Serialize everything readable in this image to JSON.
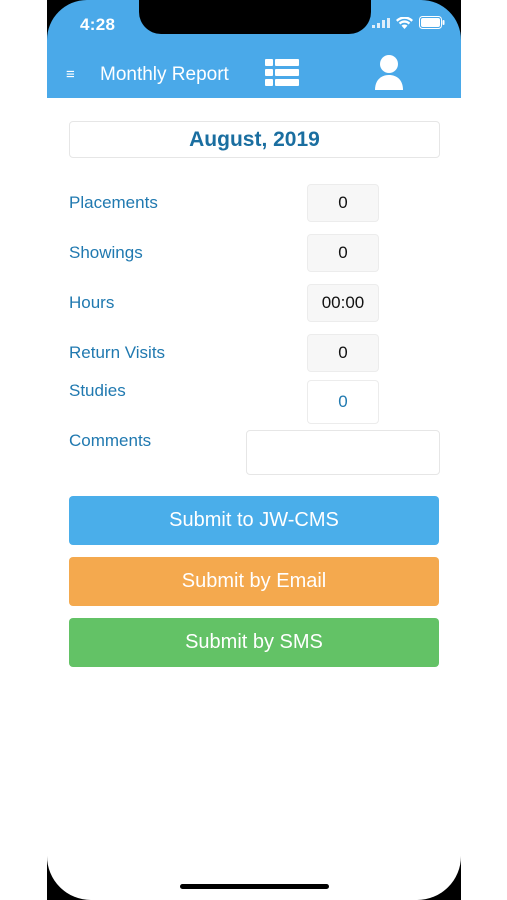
{
  "status_bar": {
    "time": "4:28",
    "icons": [
      "signal-icon",
      "wifi-icon",
      "battery-icon"
    ]
  },
  "header": {
    "menu_icon": "≡",
    "title": "Monthly Report",
    "list_icon": "list-icon",
    "user_icon": "user-icon",
    "background": "#4aa9e9"
  },
  "report": {
    "month": "August, 2019",
    "fields": [
      {
        "label": "Placements",
        "value": "0"
      },
      {
        "label": "Showings",
        "value": "0"
      },
      {
        "label": "Hours",
        "value": "00:00"
      },
      {
        "label": "Return Visits",
        "value": "0"
      },
      {
        "label": "Studies",
        "value": "0"
      },
      {
        "label": "Comments",
        "value": ""
      }
    ]
  },
  "actions": {
    "cms_label": "Submit to JW-CMS",
    "email_label": "Submit by Email",
    "sms_label": "Submit by SMS",
    "colors": {
      "cms": "#4aaeea",
      "email": "#f4a94e",
      "sms": "#63c266"
    }
  }
}
